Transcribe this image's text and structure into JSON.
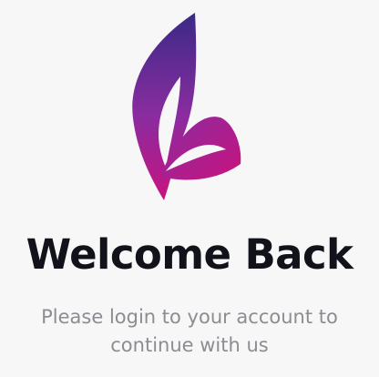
{
  "logo": {
    "icon": "butterfly-leaf-logo-icon",
    "gradient_top": "#3a2a86",
    "gradient_mid": "#8a2ca0",
    "gradient_bottom": "#c8137f"
  },
  "header": {
    "title": "Welcome Back",
    "subtitle_line1": "Please login to your account to",
    "subtitle_line2": "continue with us"
  }
}
